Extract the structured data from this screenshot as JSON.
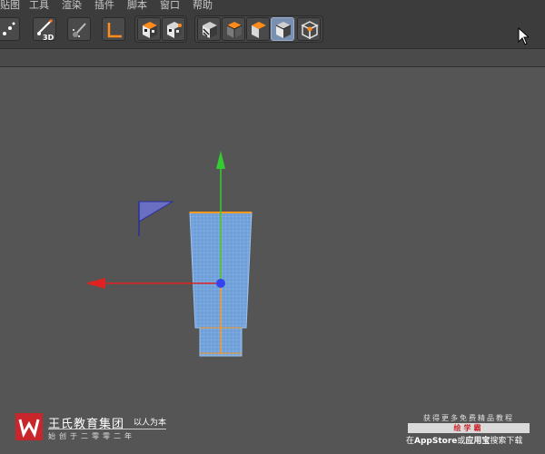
{
  "menu": {
    "items": [
      {
        "label": "贴图"
      },
      {
        "label": "工具"
      },
      {
        "label": "渲染"
      },
      {
        "label": "插件"
      },
      {
        "label": "脚本"
      },
      {
        "label": "窗口"
      },
      {
        "label": "帮助"
      }
    ]
  },
  "toolbar": {
    "tools": [
      {
        "name": "paint-tool-icon"
      },
      {
        "name": "paint-3d-icon",
        "label": "3D"
      },
      {
        "name": "sculpt-brush-icon"
      },
      {
        "name": "world-axis-icon"
      },
      {
        "name": "checker-cube-icon"
      },
      {
        "name": "checker-cube-outline-icon"
      },
      {
        "name": "display-lines-cube-icon"
      },
      {
        "name": "display-shaded-cube-icon"
      },
      {
        "name": "display-orange-cube-icon"
      },
      {
        "name": "display-isoparm-cube-icon"
      },
      {
        "name": "display-points-cube-icon"
      }
    ],
    "active_tool": "display-isoparm-cube-icon"
  },
  "branding": {
    "left": {
      "name": "王氏教育集团",
      "slogan": "以人为本",
      "sub": "始创于二零零二年"
    },
    "right": {
      "top": "获得更多免费精品教程",
      "mid": "绘学霸",
      "bottom_pre": "在",
      "bottom_app": "AppStore",
      "bottom_or": "或",
      "bottom_store": "应用宝",
      "bottom_post": "搜索下载"
    }
  },
  "colors": {
    "viewport_bg": "#555555",
    "mesh_fill": "#6f9fd8",
    "mesh_line": "#9cc4f0",
    "axis_y": "#33cc33",
    "axis_x": "#dd2222",
    "axis_z": "#3344ee",
    "pivot": "#ff9a1f",
    "brand_red": "#c8262a"
  }
}
